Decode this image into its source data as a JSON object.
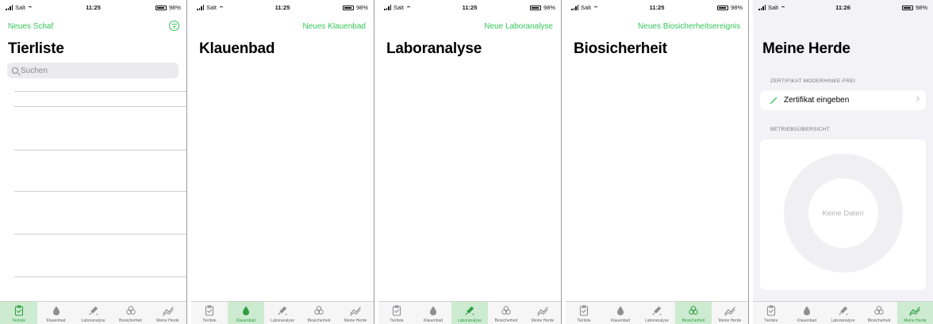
{
  "status": {
    "carrier": "Salt",
    "time_a": "11:25",
    "time_b": "11:26",
    "battery": "98%"
  },
  "tabs": [
    {
      "label": "Tierliste",
      "icon": "clipboard-check-icon"
    },
    {
      "label": "Klauenbad",
      "icon": "drop-icon"
    },
    {
      "label": "Laboranalyse",
      "icon": "pipette-icon"
    },
    {
      "label": "Biosicherheit",
      "icon": "biohazard-icon"
    },
    {
      "label": "Meine Herde",
      "icon": "chart-line-icon"
    }
  ],
  "screens": {
    "tierliste": {
      "nav_action": "Neues Schaf",
      "title": "Tierliste",
      "search_placeholder": "Suchen",
      "filter_icon": "filter-icon"
    },
    "klauenbad": {
      "nav_action": "Neues Klauenbad",
      "title": "Klauenbad"
    },
    "laboranalyse": {
      "nav_action": "Neue Laboranalyse",
      "title": "Laboranalyse"
    },
    "biosicherheit": {
      "nav_action": "Neues Biosicherheitsereignis",
      "title": "Biosicherheit"
    },
    "herde": {
      "title": "Meine Herde",
      "cert_section": "ZERTIFIKAT MODERHINKE-FREI",
      "cert_row": "Zertifikat eingeben",
      "overview_section": "BETRIEBSÜBERSICHT",
      "no_data": "Keine Daten"
    }
  },
  "colors": {
    "accent": "#34c759",
    "active_tab_bg": "#cdebd0",
    "grouped_bg": "#f2f2f7"
  }
}
